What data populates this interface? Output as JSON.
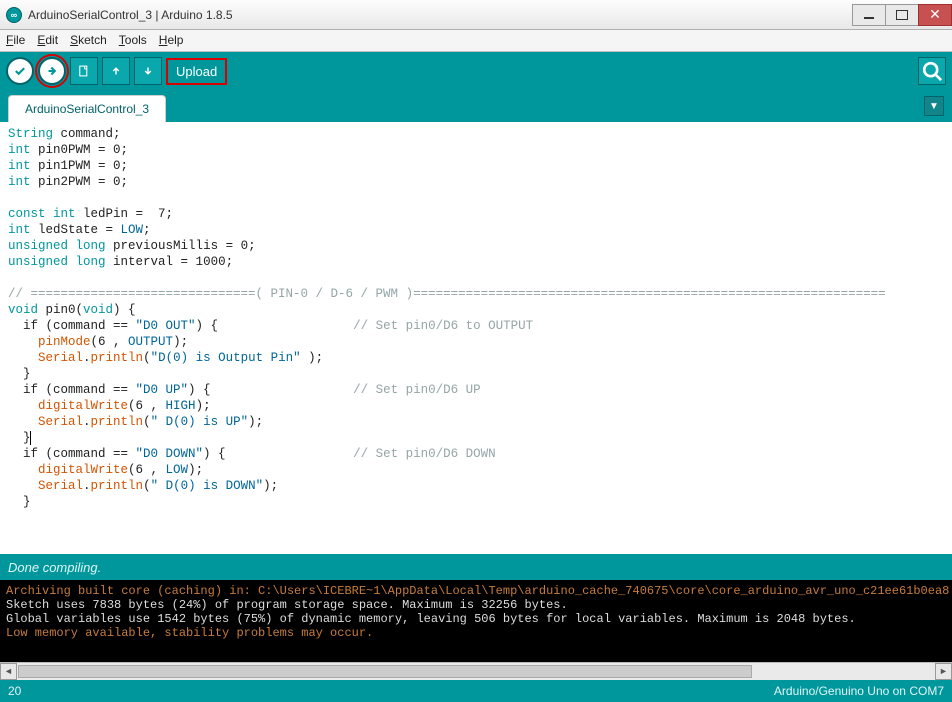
{
  "window": {
    "title": "ArduinoSerialControl_3 | Arduino 1.8.5"
  },
  "menu": {
    "file": "File",
    "edit": "Edit",
    "sketch": "Sketch",
    "tools": "Tools",
    "help": "Help"
  },
  "toolbar": {
    "upload_label": "Upload"
  },
  "tab": {
    "name": "ArduinoSerialControl_3"
  },
  "code": {
    "l01a": "String",
    "l01b": " command;",
    "l02a": "int",
    "l02b": " pin0PWM = 0;",
    "l03a": "int",
    "l03b": " pin1PWM = 0;",
    "l04a": "int",
    "l04b": " pin2PWM = 0;",
    "l06a": "const",
    "l06b": " ",
    "l06c": "int",
    "l06d": " ledPin =  7;",
    "l07a": "int",
    "l07b": " ledState = ",
    "l07c": "LOW",
    "l07d": ";",
    "l08a": "unsigned",
    "l08b": " ",
    "l08c": "long",
    "l08d": " previousMillis = 0;",
    "l09a": "unsigned",
    "l09b": " ",
    "l09c": "long",
    "l09d": " interval = 1000;",
    "l11": "// ==============================( PIN-0 / D-6 / PWM )===============================================================",
    "l12a": "void",
    "l12b": " pin0(",
    "l12c": "void",
    "l12d": ") {",
    "l13a": "  if (command == ",
    "l13b": "\"D0 OUT\"",
    "l13c": ") {                  ",
    "l13cmt": "// Set pin0/D6 to OUTPUT",
    "l14a": "    ",
    "l14b": "pinMode",
    "l14c": "(6 , ",
    "l14d": "OUTPUT",
    "l14e": ");",
    "l15a": "    ",
    "l15b": "Serial",
    "l15c": ".",
    "l15d": "println",
    "l15e": "(",
    "l15f": "\"D(0) is Output Pin\"",
    "l15g": " );",
    "l16": "  }",
    "l17a": "  if (command == ",
    "l17b": "\"D0 UP\"",
    "l17c": ") {                   ",
    "l17cmt": "// Set pin0/D6 UP",
    "l18a": "    ",
    "l18b": "digitalWrite",
    "l18c": "(6 , ",
    "l18d": "HIGH",
    "l18e": ");",
    "l19a": "    ",
    "l19b": "Serial",
    "l19c": ".",
    "l19d": "println",
    "l19e": "(",
    "l19f": "\" D(0) is UP\"",
    "l19g": ");",
    "l20": "  }",
    "l21a": "  if (command == ",
    "l21b": "\"D0 DOWN\"",
    "l21c": ") {                 ",
    "l21cmt": "// Set pin0/D6 DOWN",
    "l22a": "    ",
    "l22b": "digitalWrite",
    "l22c": "(6 , ",
    "l22d": "LOW",
    "l22e": ");",
    "l23a": "    ",
    "l23b": "Serial",
    "l23c": ".",
    "l23d": "println",
    "l23e": "(",
    "l23f": "\" D(0) is DOWN\"",
    "l23g": ");",
    "l24": "  }"
  },
  "status": {
    "text": "Done compiling."
  },
  "console": {
    "l1": "Archiving built core (caching) in: C:\\Users\\ICEBRE~1\\AppData\\Local\\Temp\\arduino_cache_740675\\core\\core_arduino_avr_uno_c21ee61b0ea8",
    "l2": "Sketch uses 7838 bytes (24%) of program storage space. Maximum is 32256 bytes.",
    "l3": "Global variables use 1542 bytes (75%) of dynamic memory, leaving 506 bytes for local variables. Maximum is 2048 bytes.",
    "l4": "Low memory available, stability problems may occur."
  },
  "footer": {
    "line": "20",
    "board": "Arduino/Genuino Uno on COM7"
  }
}
